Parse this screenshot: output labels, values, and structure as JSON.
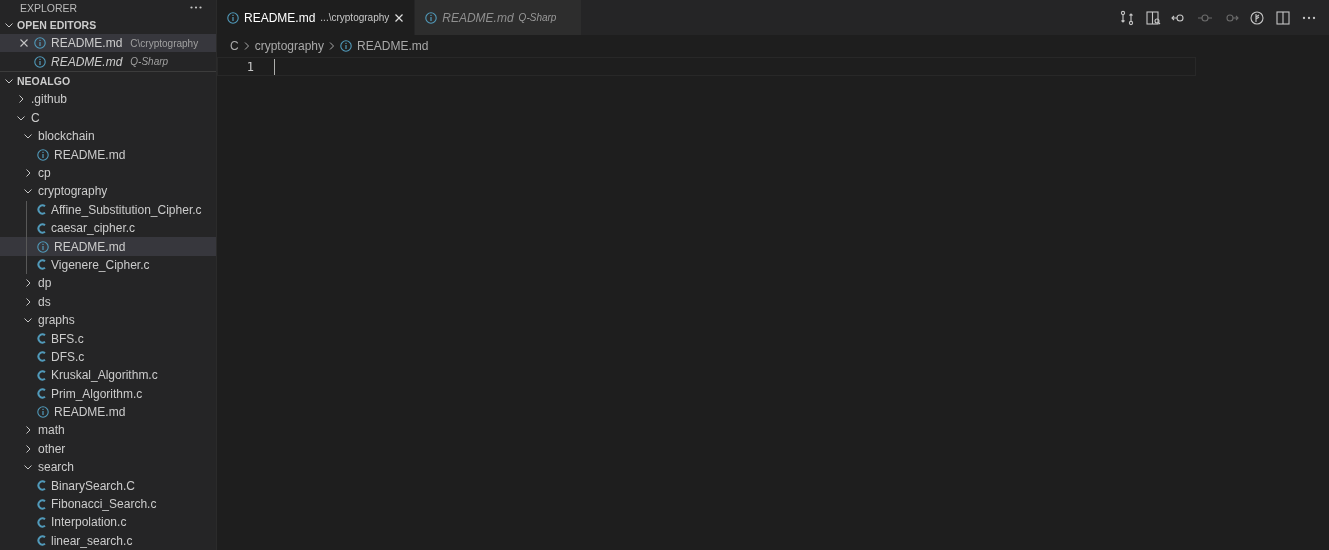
{
  "explorer": {
    "title": "EXPLORER"
  },
  "open_editors": {
    "title": "OPEN EDITORS",
    "expanded": true,
    "items": [
      {
        "name": "README.md",
        "description": "C\\cryptography",
        "kind": "markdown",
        "selected": true,
        "preview": false
      },
      {
        "name": "README.md",
        "description": "Q-Sharp",
        "kind": "markdown",
        "selected": false,
        "preview": true
      }
    ]
  },
  "folder": {
    "title": "NEOALGO",
    "expanded": true,
    "tree": [
      {
        "name": ".github",
        "kind": "folder",
        "expanded": false,
        "selected": false
      },
      {
        "name": "C",
        "kind": "folder",
        "expanded": true,
        "selected": false,
        "children": [
          {
            "name": "blockchain",
            "kind": "folder",
            "expanded": true,
            "selected": false,
            "children": [
              {
                "name": "README.md",
                "kind": "markdown",
                "selected": false
              }
            ]
          },
          {
            "name": "cp",
            "kind": "folder",
            "expanded": false,
            "selected": false
          },
          {
            "name": "cryptography",
            "kind": "folder",
            "expanded": true,
            "selected": false,
            "children": [
              {
                "name": "Affine_Substitution_Cipher.c",
                "kind": "c",
                "selected": false
              },
              {
                "name": "caesar_cipher.c",
                "kind": "c",
                "selected": false
              },
              {
                "name": "README.md",
                "kind": "markdown",
                "selected": true
              },
              {
                "name": "Vigenere_Cipher.c",
                "kind": "c",
                "selected": false
              }
            ]
          },
          {
            "name": "dp",
            "kind": "folder",
            "expanded": false,
            "selected": false
          },
          {
            "name": "ds",
            "kind": "folder",
            "expanded": false,
            "selected": false
          },
          {
            "name": "graphs",
            "kind": "folder",
            "expanded": true,
            "selected": false,
            "children": [
              {
                "name": "BFS.c",
                "kind": "c",
                "selected": false
              },
              {
                "name": "DFS.c",
                "kind": "c",
                "selected": false
              },
              {
                "name": "Kruskal_Algorithm.c",
                "kind": "c",
                "selected": false
              },
              {
                "name": "Prim_Algorithm.c",
                "kind": "c",
                "selected": false
              },
              {
                "name": "README.md",
                "kind": "markdown",
                "selected": false
              }
            ]
          },
          {
            "name": "math",
            "kind": "folder",
            "expanded": false,
            "selected": false
          },
          {
            "name": "other",
            "kind": "folder",
            "expanded": false,
            "selected": false
          },
          {
            "name": "search",
            "kind": "folder",
            "expanded": true,
            "selected": false,
            "children": [
              {
                "name": "BinarySearch.C",
                "kind": "c",
                "selected": false
              },
              {
                "name": "Fibonacci_Search.c",
                "kind": "c",
                "selected": false
              },
              {
                "name": "Interpolation.c",
                "kind": "c",
                "selected": false
              },
              {
                "name": "linear_search.c",
                "kind": "c",
                "selected": false
              }
            ]
          }
        ]
      }
    ]
  },
  "tabs": [
    {
      "name": "README.md",
      "description": "...\\cryptography",
      "kind": "markdown",
      "selected": true,
      "preview": false
    },
    {
      "name": "README.md",
      "description": "Q-Sharp",
      "kind": "markdown",
      "selected": false,
      "preview": true
    }
  ],
  "toolbar": [
    {
      "kind": "changes",
      "disabled": false
    },
    {
      "kind": "preview",
      "disabled": false
    },
    {
      "kind": "back",
      "disabled": false
    },
    {
      "kind": "previous",
      "disabled": true
    },
    {
      "kind": "next",
      "disabled": true
    },
    {
      "kind": "timeline",
      "disabled": false
    },
    {
      "kind": "split",
      "disabled": false
    },
    {
      "kind": "more",
      "disabled": false
    }
  ],
  "breadcrumbs": [
    {
      "label": "C",
      "kind": "folder"
    },
    {
      "label": "cryptography",
      "kind": "folder"
    },
    {
      "label": "README.md",
      "kind": "markdown"
    }
  ],
  "editor": {
    "line_numbers": [
      "1"
    ]
  }
}
